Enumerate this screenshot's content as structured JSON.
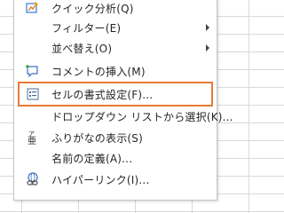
{
  "context_menu": {
    "items": [
      {
        "label": "クイック分析(Q)",
        "icon": "quick-analysis-icon"
      },
      {
        "label": "フィルター(E)",
        "icon": "",
        "submenu": true
      },
      {
        "label": "並べ替え(O)",
        "icon": "",
        "submenu": true
      },
      {
        "label": "コメントの挿入(M)",
        "icon": "insert-comment-icon"
      },
      {
        "label": "セルの書式設定(F)...",
        "icon": "format-cells-icon",
        "highlighted": true
      },
      {
        "label": "ドロップダウン リストから選択(K)...",
        "icon": ""
      },
      {
        "label": "ふりがなの表示(S)",
        "icon": "furigana-icon"
      },
      {
        "label": "名前の定義(A)...",
        "icon": ""
      },
      {
        "label": "ハイパーリンク(I)...",
        "icon": "hyperlink-icon"
      }
    ],
    "highlight_color": "#e87a35"
  }
}
